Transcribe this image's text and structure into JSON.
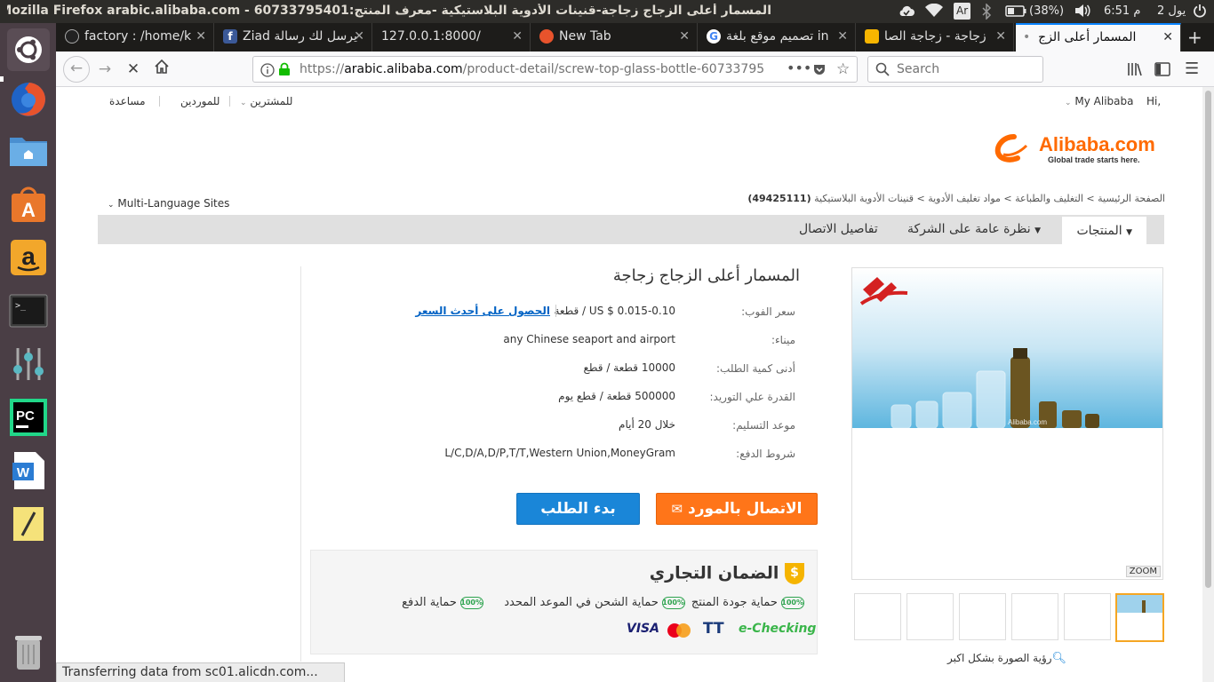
{
  "system": {
    "window_title": "المسمار أعلى الزجاج زجاجة-قنينات الأدوية البلاستيكية -معرف المنتج:60733795401 - Mozilla Firefox arabic.alibaba.com",
    "keyboard_layout": "Ar",
    "battery": "(38%)",
    "clock": "6:51 م",
    "date": "2 يول"
  },
  "launcher": {
    "items": [
      "ubuntu-dash-icon",
      "firefox-icon",
      "files-icon",
      "software-center-icon",
      "amazon-icon",
      "terminal-icon",
      "system-settings-icon",
      "pycharm-icon",
      "writer-icon",
      "text-editor-icon",
      "trash-icon"
    ]
  },
  "tabs": [
    {
      "label": "factory : /home/k",
      "icon": "github-icon"
    },
    {
      "label": "Ziad يرسل لك رسالة",
      "icon": "facebook-icon"
    },
    {
      "label": "127.0.0.1:8000/",
      "icon": "none"
    },
    {
      "label": "New Tab",
      "icon": "firefox-icon"
    },
    {
      "label": "تصميم موقع بلغة in",
      "icon": "google-icon"
    },
    {
      "label": "زجاجة - زجاجة الصا",
      "icon": "alibaba-icon"
    },
    {
      "label": "المسمار أعلى الزج",
      "icon": "none",
      "active": true
    }
  ],
  "nav": {
    "url_prefix": "https://",
    "url_domain": "arabic.alibaba.com",
    "url_path": "/product-detail/screw-top-glass-bottle-60733795",
    "search_placeholder": "Search"
  },
  "header": {
    "greeting": "Hi,",
    "my_alibaba": "My Alibaba",
    "help": "مساعدة",
    "suppliers": "للموردين",
    "buyers": "للمشترين",
    "logo_text": "Alibaba.com",
    "logo_tagline": "Global trade starts here.",
    "multi_language": "Multi-Language Sites"
  },
  "breadcrumb": {
    "text": "الصفحة الرئيسية > التغليف والطباعة > مواد تغليف الأدوية > قنينات الأدوية البلاستيكية",
    "count": "(49425111)"
  },
  "category_nav": {
    "products": "المنتجات",
    "company_overview": "نظرة عامة على الشركة",
    "contact_details": "تفاصيل الاتصال"
  },
  "product": {
    "title": "المسمار أعلى الزجاج زجاجة",
    "fields": [
      {
        "label": "سعر الفوب:",
        "value": "US $ 0.015-0.10 / قطعة",
        "link": "الحصول على أحدث السعر"
      },
      {
        "label": "ميناء:",
        "value": "any Chinese seaport and airport"
      },
      {
        "label": "أدنى كمية الطلب:",
        "value": "10000 قطعة / قطع"
      },
      {
        "label": "القدرة علي التوريد:",
        "value": "500000 قطعة / قطع يوم"
      },
      {
        "label": "موعد التسليم:",
        "value": "خلال 20 أيام"
      },
      {
        "label": "شروط الدفع:",
        "value": "L/C,D/A,D/P,T/T,Western Union,MoneyGram"
      }
    ],
    "contact_button": "الاتصال بالمورد",
    "order_button": "بدء الطلب"
  },
  "trade_assurance": {
    "title": "الضمان التجاري",
    "items": [
      "حماية جودة المنتج",
      "حماية الشحن في الموعد المحدد",
      "حماية الدفع"
    ],
    "percent": "100%",
    "payments": [
      "e-Checking",
      "TT",
      "MasterCard",
      "VISA"
    ]
  },
  "gallery": {
    "zoom_label": "ZOOM",
    "watermark": "Alibaba.com",
    "view_larger": "رؤية الصورة بشكل اكبر"
  },
  "status_bar": "Transferring data from sc01.alicdn.com..."
}
